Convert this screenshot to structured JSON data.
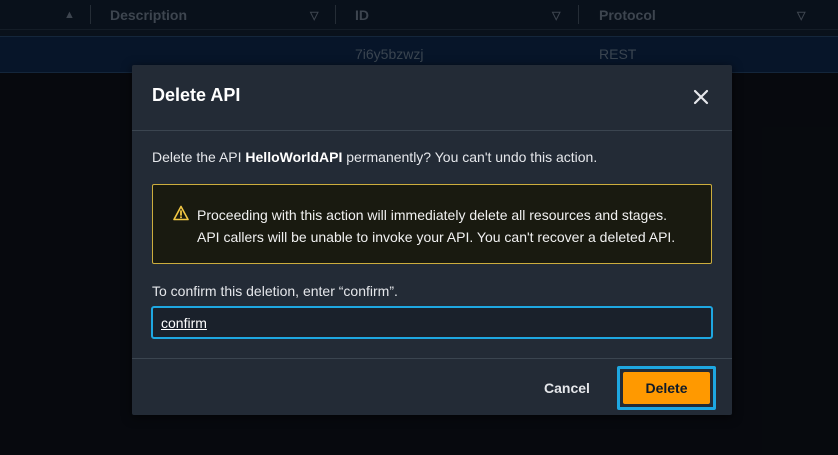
{
  "table": {
    "columns": [
      {
        "label": "",
        "sort_icon": "▲"
      },
      {
        "label": "Description",
        "sort_icon": "▽"
      },
      {
        "label": "ID",
        "sort_icon": "▽"
      },
      {
        "label": "Protocol",
        "sort_icon": "▽"
      }
    ],
    "row": {
      "id": "7i6y5bzwzj",
      "protocol": "REST"
    }
  },
  "modal": {
    "title": "Delete API",
    "intro_prefix": "Delete the API ",
    "api_name": "HelloWorldAPI",
    "intro_suffix": " permanently? You can't undo this action.",
    "warning_line1": "Proceeding with this action will immediately delete all resources and stages.",
    "warning_line2": "API callers will be unable to invoke your API. You can't recover a deleted API.",
    "confirm_label": "To confirm this deletion, enter “confirm”.",
    "confirm_value": "confirm",
    "cancel_label": "Cancel",
    "delete_label": "Delete"
  },
  "colors": {
    "accent": "#ff9900",
    "focus": "#1ea7e1",
    "warning_border": "#ccad3d"
  },
  "icons": {
    "close": "close-icon",
    "warning": "warning-icon",
    "sort": "sort-icon"
  }
}
